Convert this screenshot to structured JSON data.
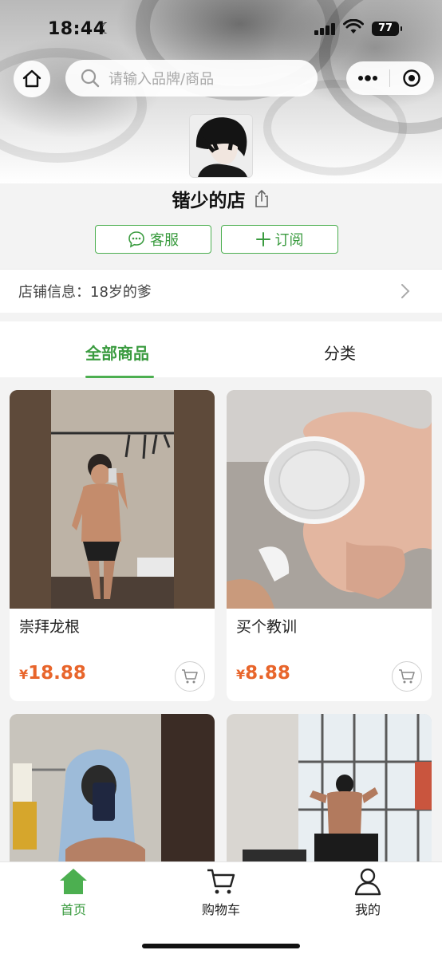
{
  "status_bar": {
    "time": "18:44",
    "battery": "77"
  },
  "search": {
    "placeholder": "请输入品牌/商品"
  },
  "shop": {
    "name": "锴少的店",
    "service_label": "客服",
    "subscribe_label": "订阅",
    "info_text": "店铺信息：18岁的爹"
  },
  "tabs": [
    {
      "label": "全部商品",
      "active": true
    },
    {
      "label": "分类",
      "active": false
    }
  ],
  "products": [
    {
      "title": "崇拜龙根",
      "currency": "¥",
      "price": "18.88"
    },
    {
      "title": "买个教训",
      "currency": "¥",
      "price": "8.88"
    },
    {
      "title": "",
      "currency": "",
      "price": ""
    },
    {
      "title": "",
      "currency": "",
      "price": ""
    }
  ],
  "bottom_nav": [
    {
      "label": "首页",
      "icon": "home-icon",
      "active": true
    },
    {
      "label": "购物车",
      "icon": "cart-icon",
      "active": false
    },
    {
      "label": "我的",
      "icon": "user-icon",
      "active": false
    }
  ],
  "colors": {
    "accent": "#4caf50",
    "price": "#e8652b"
  }
}
